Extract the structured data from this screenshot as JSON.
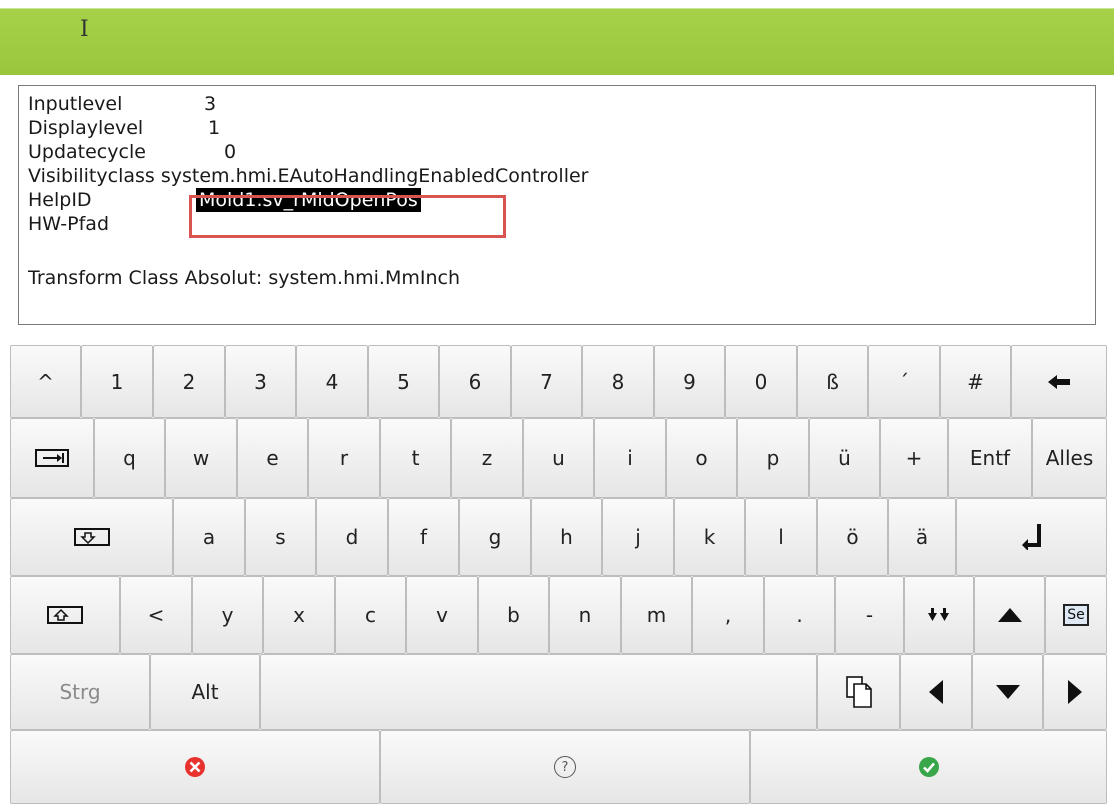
{
  "info": {
    "rows": [
      {
        "label": "Inputlevel",
        "value": "3"
      },
      {
        "label": "Displaylevel",
        "value": "1"
      },
      {
        "label": "Updatecycle",
        "value": "0"
      },
      {
        "label": "Visibilityclass",
        "value": "system.hmi.EAutoHandlingEnabledController"
      },
      {
        "label": "HelpID",
        "value": "Mold1.sv_rMldOpenPos"
      },
      {
        "label": "HW-Pfad",
        "value": ""
      }
    ],
    "transform": "Transform Class Absolut: system.hmi.MmInch"
  },
  "keyboard": {
    "row1": [
      "^",
      "1",
      "2",
      "3",
      "4",
      "5",
      "6",
      "7",
      "8",
      "9",
      "0",
      "ß",
      "´",
      "#"
    ],
    "row2": [
      "q",
      "w",
      "e",
      "r",
      "t",
      "z",
      "u",
      "i",
      "o",
      "p",
      "ü",
      "+",
      "Entf",
      "Alles"
    ],
    "row3": [
      "a",
      "s",
      "d",
      "f",
      "g",
      "h",
      "j",
      "k",
      "l",
      "ö",
      "ä"
    ],
    "row4": [
      "<",
      "y",
      "x",
      "c",
      "v",
      "b",
      "n",
      "m",
      ",",
      ".",
      "-"
    ],
    "row5": [
      "Strg",
      "Alt"
    ],
    "select_label": "Se",
    "help_glyph": "?"
  },
  "colors": {
    "header": "#9ccb41",
    "highlight": "#d9534f",
    "cancel": "#e8322e",
    "confirm": "#3aa64a"
  },
  "icons": {
    "backspace": "backspace-arrow-icon",
    "tab": "tab-icon",
    "caps": "caps-lock-icon",
    "enter": "enter-icon",
    "shift": "shift-icon",
    "page_down": "double-down-arrow-icon",
    "paste": "paste-icon",
    "cancel": "cancel-icon",
    "help": "help-icon",
    "confirm": "confirm-icon"
  }
}
